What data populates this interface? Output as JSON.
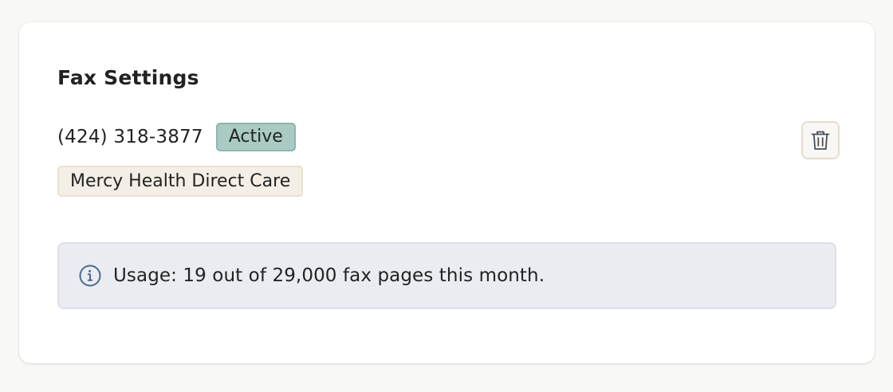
{
  "section": {
    "title": "Fax Settings"
  },
  "fax_number": {
    "phone": "(424) 318-3877",
    "status": "Active",
    "organization": "Mercy Health Direct Care"
  },
  "actions": {
    "delete_icon": "trash-icon"
  },
  "usage": {
    "icon": "info-icon",
    "text": "Usage: 19 out of 29,000 fax pages this month."
  },
  "colors": {
    "status_active_bg": "#a9cbc4",
    "org_tag_bg": "#f4efe6",
    "notice_bg": "#eaecf1",
    "info_icon": "#4a6a8e"
  }
}
